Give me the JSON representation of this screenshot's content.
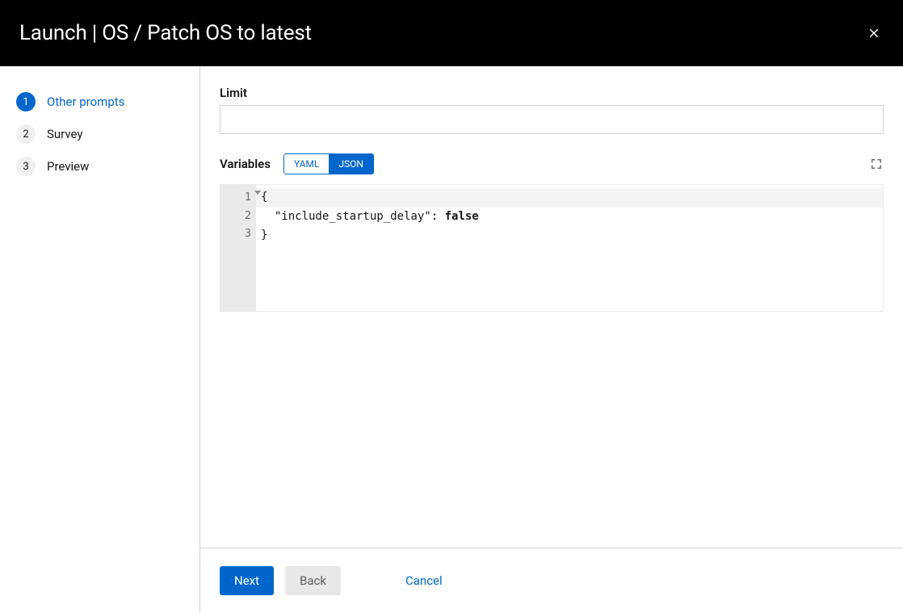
{
  "header": {
    "title": "Launch | OS / Patch OS to latest"
  },
  "steps": [
    {
      "num": "1",
      "label": "Other prompts",
      "active": true
    },
    {
      "num": "2",
      "label": "Survey",
      "active": false
    },
    {
      "num": "3",
      "label": "Preview",
      "active": false
    }
  ],
  "form": {
    "limit_label": "Limit",
    "limit_value": "",
    "variables_label": "Variables",
    "format_options": {
      "yaml": "YAML",
      "json": "JSON"
    },
    "format_selected": "JSON",
    "code": {
      "line_numbers": [
        "1",
        "2",
        "3"
      ],
      "line1": "{",
      "line2_key": "\"include_startup_delay\"",
      "line2_sep": ": ",
      "line2_val": "false",
      "line3": "}"
    }
  },
  "footer": {
    "next": "Next",
    "back": "Back",
    "cancel": "Cancel"
  }
}
